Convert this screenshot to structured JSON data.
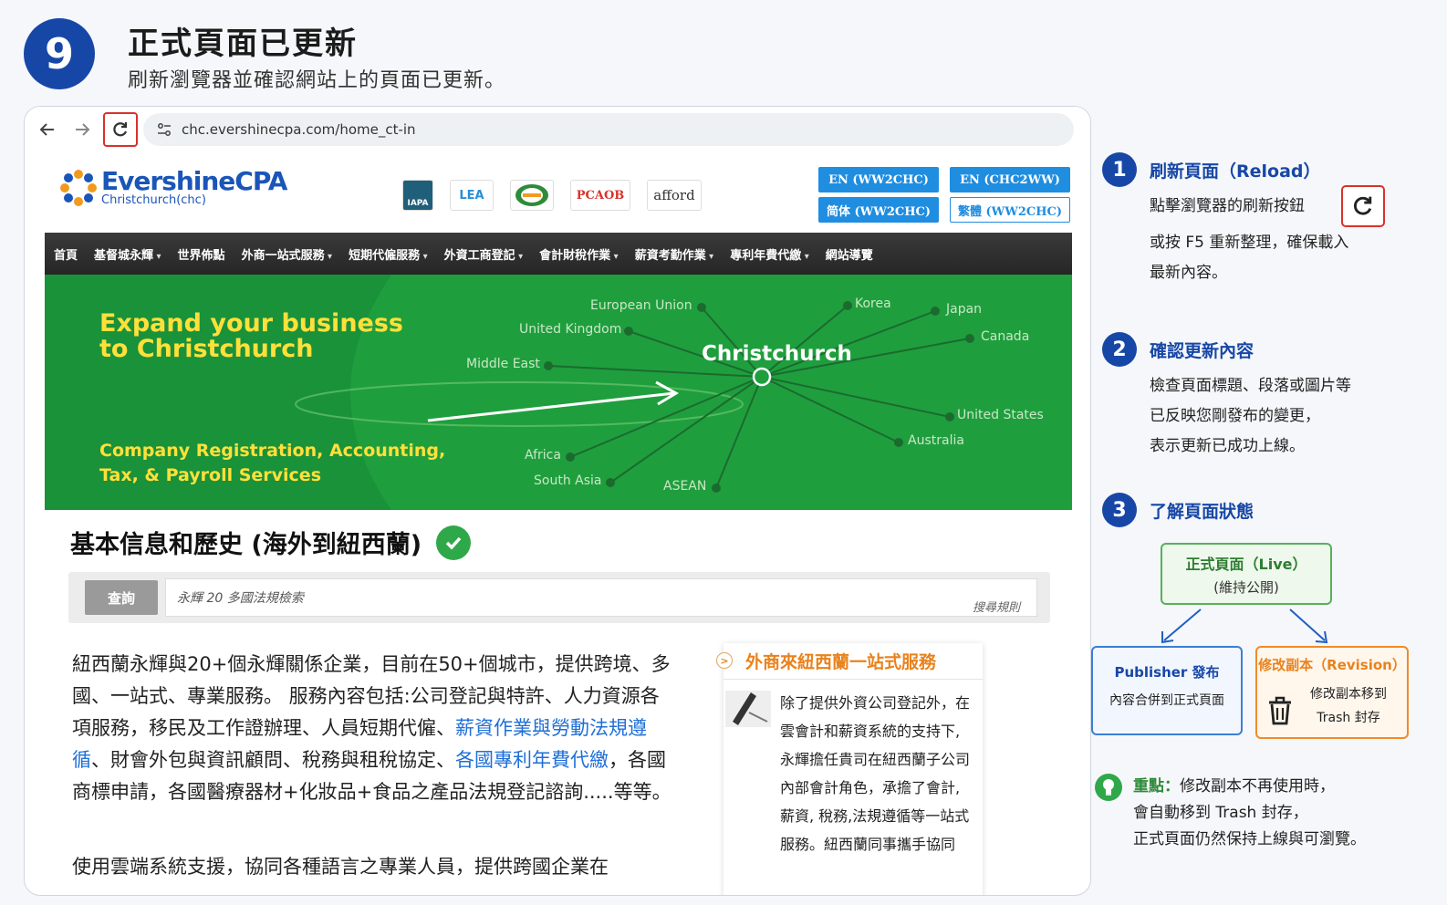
{
  "step": {
    "number": "9",
    "title": "正式頁面已更新",
    "subtitle": "刷新瀏覽器並確認網站上的頁面已更新。"
  },
  "browser": {
    "url": "chc.evershinecpa.com/home_ct-in"
  },
  "site": {
    "logo_name": "EvershineCPA",
    "logo_sub": "Christchurch(chc)",
    "partner_badges": [
      "IAPA",
      "LEA",
      "EA",
      "PCAOB",
      "afford"
    ],
    "lang_buttons": [
      "EN (WW2CHC)",
      "EN (CHC2WW)",
      "简体 (WW2CHC)",
      "繁體 (WW2CHC)"
    ],
    "menu": [
      "首頁",
      "基督城永輝",
      "世界佈點",
      "外商一站式服務",
      "短期代僱服務",
      "外資工商登記",
      "會計財稅作業",
      "薪資考勤作業",
      "專利年費代繳",
      "網站導覽"
    ],
    "hero": {
      "title_line1": "Expand your business",
      "title_line2": "to Christchurch",
      "sub_line1": "Company Registration, Accounting,",
      "sub_line2": "Tax, & Payroll Services",
      "city": "Christchurch",
      "destinations": [
        "European Union",
        "United Kingdom",
        "Middle East",
        "Korea",
        "Japan",
        "Canada",
        "United States",
        "Australia",
        "Africa",
        "South Asia",
        "ASEAN"
      ]
    },
    "section_title": "基本信息和歷史 (海外到紐西蘭)",
    "search": {
      "button": "查詢",
      "placeholder": "永輝 20 多國法規檢索",
      "rule": "搜尋規則"
    },
    "body": {
      "p1_a": "紐西蘭永輝與20+個永輝關係企業，目前在50+個城市，提供跨境、多國、一站式、專業服務。 服務內容包括:公司登記與特許、人力資源各項服務，移民及工作證辦理、人員短期代僱、",
      "p1_link1": "薪資作業與勞動法規遵循",
      "p1_b": "、財會外包與資訊顧問、稅務與租稅協定、",
      "p1_link2": "各國專利年費代繳",
      "p1_c": "，各國商標申請，各國醫療器材+化妝品+食品之產品法規登記諮詢.....等等。",
      "p2": "使用雲端系統支援，協同各種語言之專業人員，提供跨國企業在"
    },
    "side_card": {
      "title": "外商來紐西蘭一站式服務",
      "text": "除了提供外資公司登記外，在雲會計和薪資系統的支持下,永輝擔任貴司在紐西蘭子公司內部會計角色，承擔了會計,薪資, 稅務,法規遵循等一站式服務。紐西蘭同事攜手協同"
    }
  },
  "right_panel": {
    "items": [
      {
        "num": "1",
        "title": "刷新頁面（Reload）",
        "line1": "點擊瀏覽器的刷新按鈕",
        "line2": "或按 F5 重新整理，確保載入",
        "line3": "最新內容。"
      },
      {
        "num": "2",
        "title": "確認更新內容",
        "line1": "檢查頁面標題、段落或圖片等",
        "line2": "已反映您剛發布的變更，",
        "line3": "表示更新已成功上線。"
      },
      {
        "num": "3",
        "title": "了解頁面狀態"
      }
    ],
    "states": {
      "live_title": "正式頁面（Live）",
      "live_sub": "(維持公開)",
      "pub_title": "Publisher 發布",
      "pub_sub": "內容合併到正式頁面",
      "rev_title": "修改副本（Revision）",
      "rev_sub1": "修改副本移到",
      "rev_sub2": "Trash 封存"
    },
    "tip": {
      "label": "重點：",
      "line1": "修改副本不再使用時，",
      "line2": "會自動移到 Trash 封存，",
      "line3": "正式頁面仍然保持上線與可瀏覽。"
    }
  },
  "colors": {
    "primary_blue": "#1747a6",
    "highlight_red": "#d9322b",
    "hero_green": "#1f9e3e",
    "hero_yellow": "#ffe03a",
    "revision_orange": "#e9821c"
  }
}
